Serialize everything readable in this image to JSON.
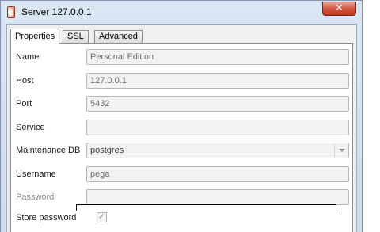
{
  "window": {
    "title": "Server 127.0.0.1",
    "close_label": "✕"
  },
  "tabs": [
    {
      "label": "Properties",
      "active": true
    },
    {
      "label": "SSL",
      "active": false
    },
    {
      "label": "Advanced",
      "active": false
    }
  ],
  "form": {
    "name": {
      "label": "Name",
      "value": "Personal Edition"
    },
    "host": {
      "label": "Host",
      "value": "127.0.0.1"
    },
    "port": {
      "label": "Port",
      "value": "5432"
    },
    "service": {
      "label": "Service",
      "value": ""
    },
    "maintenance_db": {
      "label": "Maintenance DB",
      "value": "postgres"
    },
    "username": {
      "label": "Username",
      "value": "pega"
    },
    "password": {
      "label": "Password",
      "value": ""
    },
    "store_password": {
      "label": "Store password",
      "checked": true,
      "check_glyph": "✓"
    }
  }
}
